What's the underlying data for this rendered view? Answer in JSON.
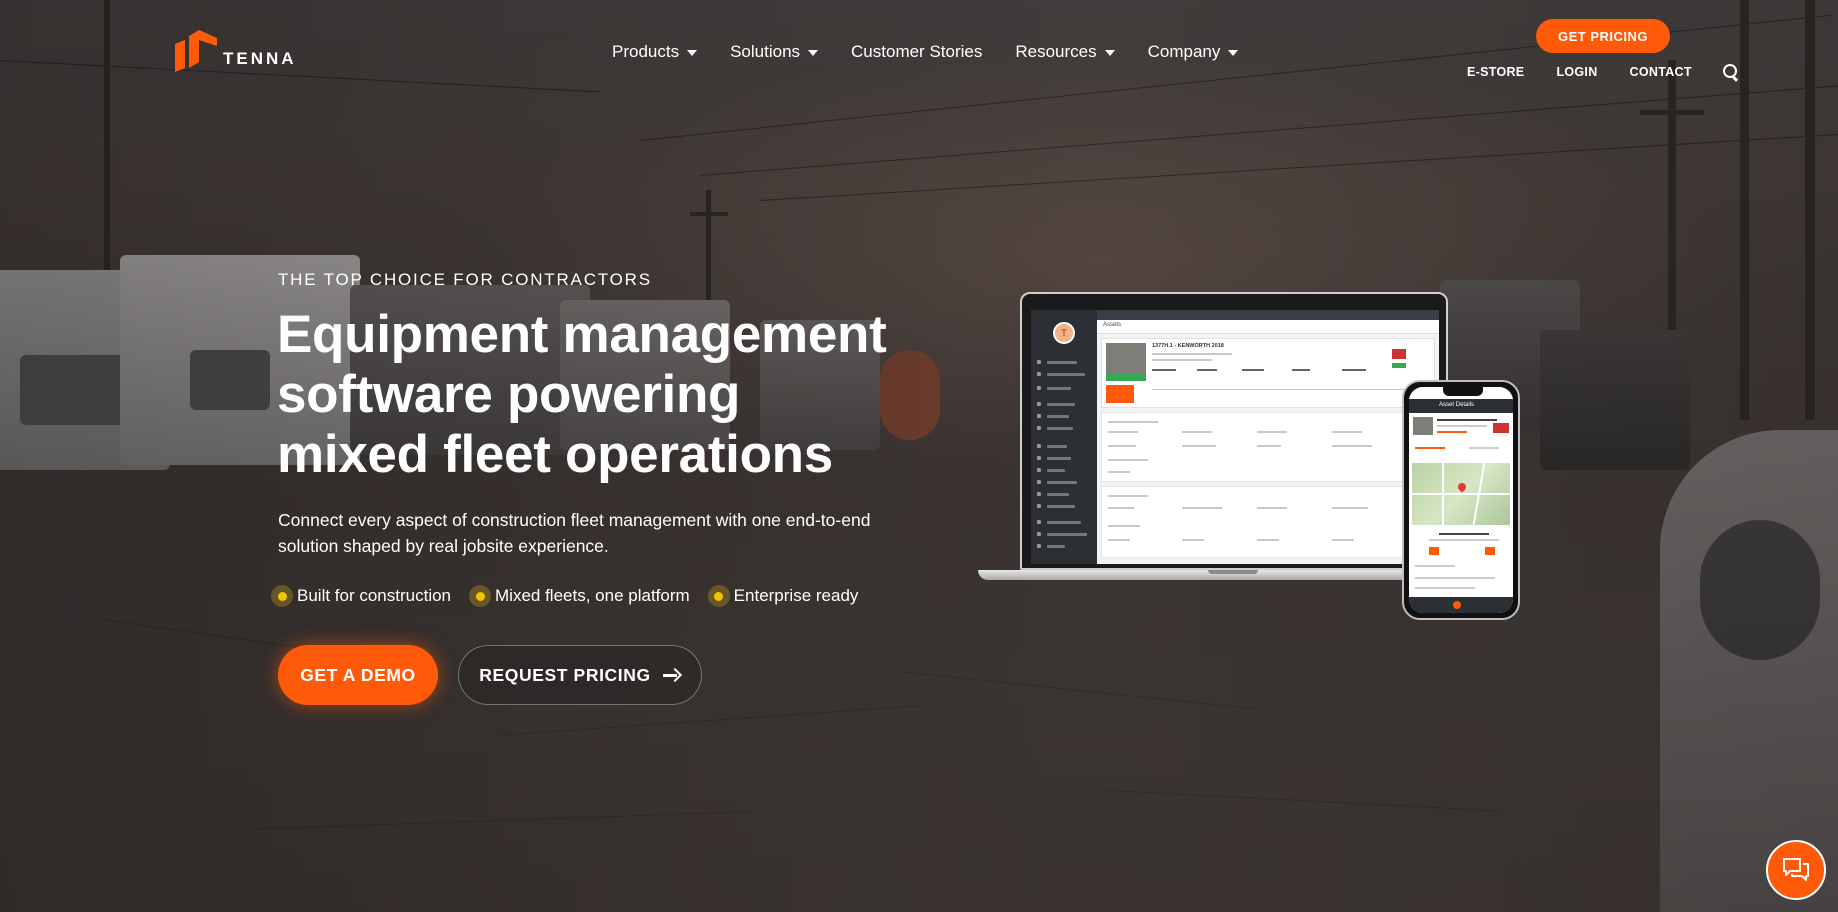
{
  "brand": {
    "logo_text": "TENNA",
    "accent": "#ff5a0a",
    "bullet_accent": "#f4c400"
  },
  "nav": {
    "items": [
      {
        "label": "Products",
        "has_dropdown": true
      },
      {
        "label": "Solutions",
        "has_dropdown": true
      },
      {
        "label": "Customer Stories",
        "has_dropdown": false
      },
      {
        "label": "Resources",
        "has_dropdown": true
      },
      {
        "label": "Company",
        "has_dropdown": true
      }
    ],
    "cta_label": "GET PRICING",
    "utility": [
      "E-STORE",
      "LOGIN",
      "CONTACT"
    ],
    "search_icon": "search-icon"
  },
  "hero": {
    "eyebrow": "THE TOP CHOICE FOR CONTRACTORS",
    "headline_lines": [
      "Equipment management",
      "software powering",
      "mixed fleet operations"
    ],
    "subtext": "Connect every aspect of construction fleet management with one end-to-end solution shaped by real jobsite experience.",
    "bullets": [
      "Built for construction",
      "Mixed fleets, one platform",
      "Enterprise ready"
    ],
    "primary_cta": "GET A DEMO",
    "secondary_cta": "REQUEST PRICING",
    "secondary_cta_icon": "arrow-right-icon"
  },
  "mockup": {
    "avatar_letter": "T",
    "laptop_app_title": "Assets",
    "laptop_asset_title": "1377H.1 - KENWORTH 2018",
    "phone_header_title": "Asset Details"
  },
  "chat": {
    "icon": "chat-bubbles-icon"
  }
}
